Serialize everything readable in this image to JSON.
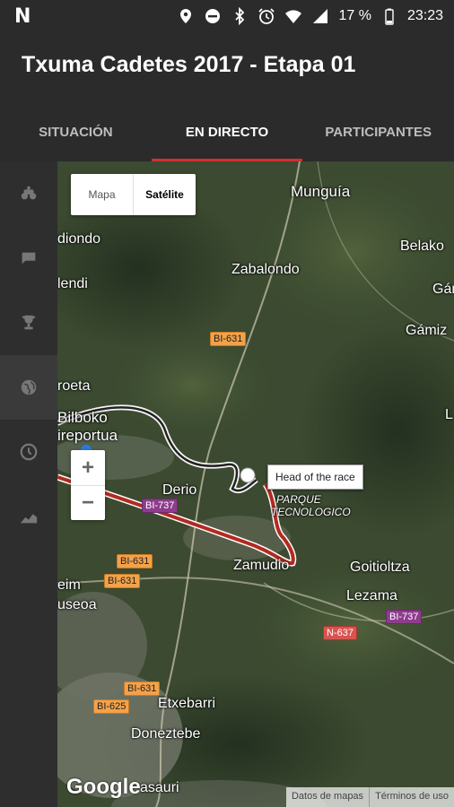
{
  "status_bar": {
    "app_icon": "N",
    "battery_percent": "17 %",
    "time": "23:23",
    "icons": [
      "location-icon",
      "dnd-icon",
      "bluetooth-icon",
      "alarm-icon",
      "wifi-icon",
      "signal-icon",
      "battery-icon"
    ]
  },
  "app_bar": {
    "title": "Txuma Cadetes 2017 - Etapa 01"
  },
  "tabs": [
    {
      "label": "SITUACIÓN"
    },
    {
      "label": "EN DIRECTO"
    },
    {
      "label": "PARTICIPANTES"
    }
  ],
  "active_tab": "EN DIRECTO",
  "sidebar": {
    "items": [
      "bike-icon",
      "chat-icon",
      "trophy-icon",
      "globe-icon",
      "clock-icon",
      "elevation-icon"
    ],
    "active": "globe-icon"
  },
  "map": {
    "type_toggle": {
      "map_label": "Mapa",
      "satellite_label": "Satélite",
      "selected": "Satélite"
    },
    "zoom": {
      "in_label": "+",
      "out_label": "−"
    },
    "info_window": "Head of the race",
    "places": {
      "munguia": "Munguía",
      "belako": "Belako",
      "diondo": "diondo",
      "lendi": "lendi",
      "zabalondo": "Zabalondo",
      "gam": "Gám",
      "gamiz": "Gámiz",
      "roeta": "roeta",
      "bilboko": "Bilboko",
      "aireportua": "ireportua",
      "derio": "Derio",
      "parque": "PARQUE",
      "tecnologico": "TECNOLOGICO",
      "zamudio": "Zamudio",
      "goitioltza": "Goitioltza",
      "lezama": "Lezama",
      "eim": "eim",
      "useoa": "useoa",
      "etxebarri": "Etxebarri",
      "doneztebe": "Doneztebe",
      "basauri": "asauri",
      "l_edge": "L"
    },
    "road_labels": {
      "bi631_a": "BI-631",
      "bi631_b": "BI-631",
      "bi631_c": "BI-631",
      "bi631_d": "BI-631",
      "bi737_a": "BI-737",
      "bi737_b": "BI-737",
      "n637": "N-637",
      "bi625": "BI-625"
    },
    "google_logo": "Google",
    "attribution": {
      "data": "Datos de mapas",
      "terms": "Términos de uso"
    },
    "colors": {
      "race_route": "#b22a20",
      "route_outline": "#ffffff",
      "track_dark": "#222222"
    }
  }
}
